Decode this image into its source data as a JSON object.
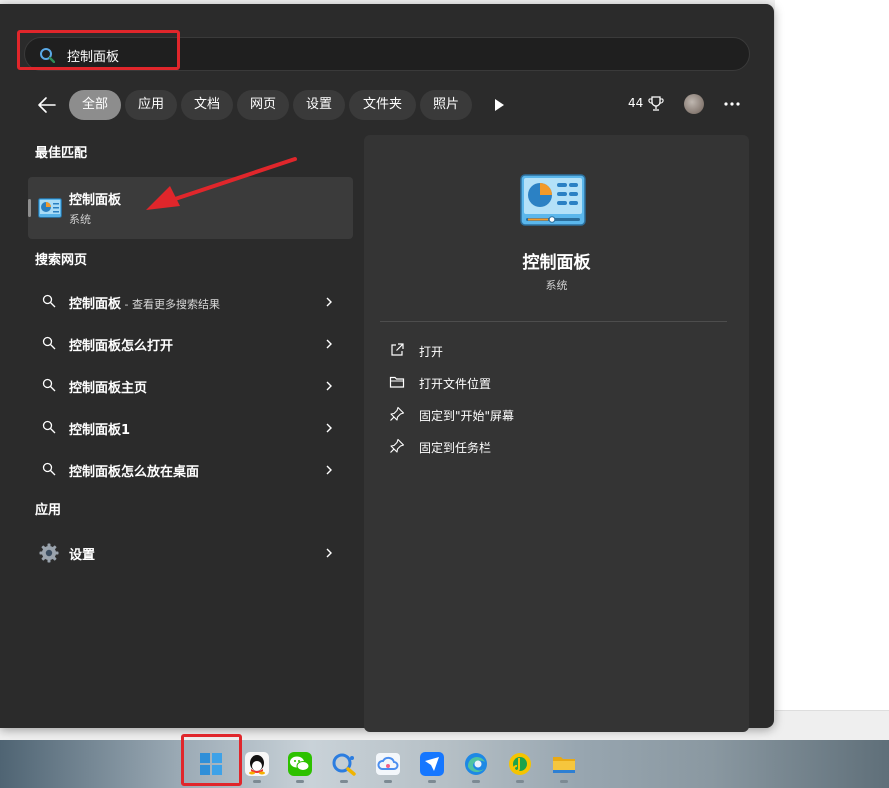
{
  "search": {
    "query": "控制面板"
  },
  "filters": [
    {
      "label": "全部",
      "active": true
    },
    {
      "label": "应用",
      "active": false
    },
    {
      "label": "文档",
      "active": false
    },
    {
      "label": "网页",
      "active": false
    },
    {
      "label": "设置",
      "active": false
    },
    {
      "label": "文件夹",
      "active": false
    },
    {
      "label": "照片",
      "active": false
    }
  ],
  "rewards": {
    "count": "44"
  },
  "sections": {
    "best_match": "最佳匹配",
    "search_web": "搜索网页",
    "apps": "应用"
  },
  "best_match": {
    "title": "控制面板",
    "subtitle": "系统",
    "icon": "control-panel-icon"
  },
  "web_results": [
    {
      "text": "控制面板",
      "suffix": " - 查看更多搜索结果"
    },
    {
      "text": "控制面板怎么打开",
      "suffix": ""
    },
    {
      "text": "控制面板主页",
      "suffix": ""
    },
    {
      "text": "控制面板1",
      "suffix": ""
    },
    {
      "text": "控制面板怎么放在桌面",
      "suffix": ""
    }
  ],
  "apps": [
    {
      "label": "设置",
      "icon": "settings-gear-icon"
    }
  ],
  "preview": {
    "title": "控制面板",
    "subtitle": "系统",
    "actions": [
      {
        "label": "打开",
        "icon": "open-external-icon"
      },
      {
        "label": "打开文件位置",
        "icon": "folder-icon"
      },
      {
        "label": "固定到\"开始\"屏幕",
        "icon": "pin-icon"
      },
      {
        "label": "固定到任务栏",
        "icon": "pin-icon"
      }
    ]
  },
  "taskbar": {
    "items": [
      "windows-start-icon",
      "qq-icon",
      "wechat-icon",
      "browser-search-icon",
      "cloud-drive-icon",
      "feishu-icon",
      "edge-icon",
      "music-icon",
      "file-explorer-icon"
    ]
  },
  "colors": {
    "highlight": "#e0262b",
    "panel": "#2b2b2b",
    "preview": "#343434"
  }
}
